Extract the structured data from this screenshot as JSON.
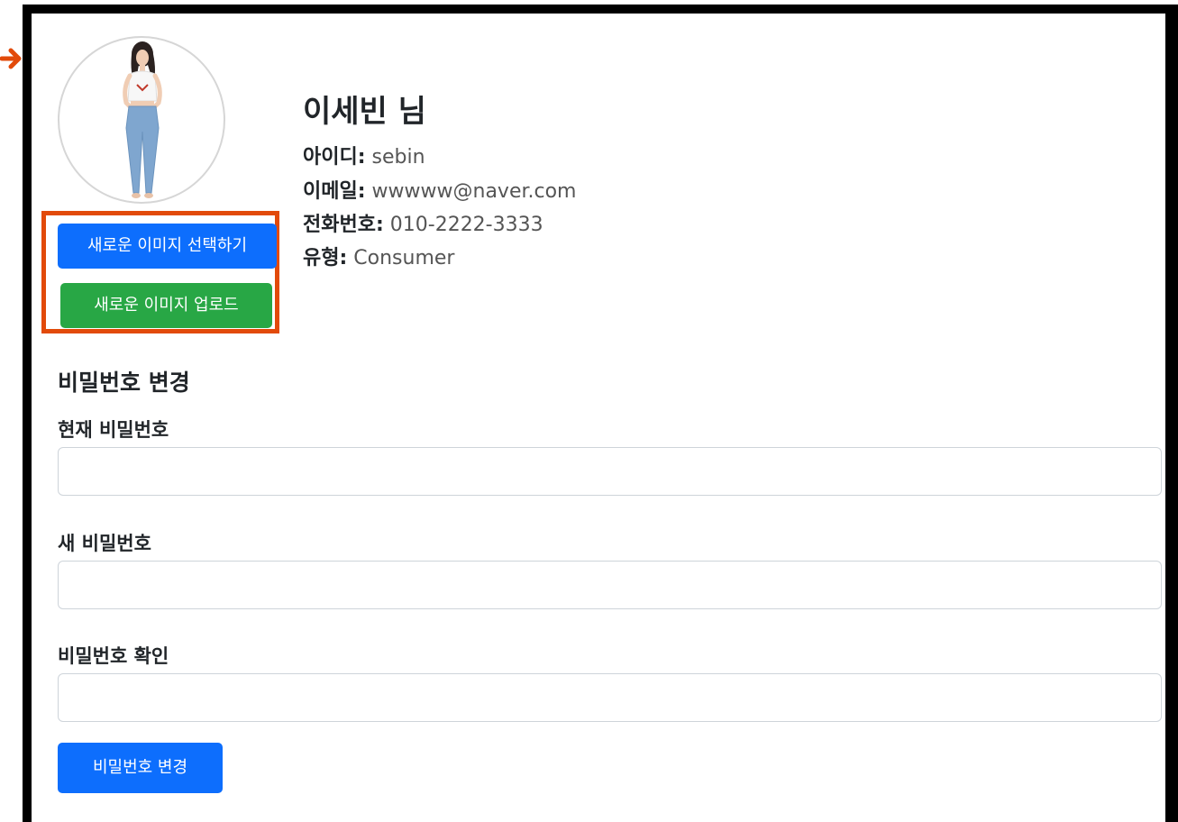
{
  "profile": {
    "avatar_icon": "user-photo-icon",
    "name": "이세빈 님",
    "info": [
      {
        "label": "아이디:",
        "value": "sebin"
      },
      {
        "label": "이메일:",
        "value": "wwwww@naver.com"
      },
      {
        "label": "전화번호:",
        "value": "010-2222-3333"
      },
      {
        "label": "유형:",
        "value": "Consumer"
      }
    ]
  },
  "image_actions": {
    "select_label": "새로운 이미지 선택하기",
    "upload_label": "새로운 이미지 업로드"
  },
  "password_section": {
    "title": "비밀번호 변경",
    "fields": [
      {
        "label": "현재 비밀번호",
        "value": ""
      },
      {
        "label": "새 비밀번호",
        "value": ""
      },
      {
        "label": "비밀번호 확인",
        "value": ""
      }
    ],
    "submit_label": "비밀번호 변경"
  },
  "colors": {
    "primary": "#0d6efd",
    "success": "#28a745",
    "highlight": "#e24a0a",
    "frame": "#000000"
  },
  "annotation": {
    "arrow_icon": "arrow-right-icon"
  }
}
